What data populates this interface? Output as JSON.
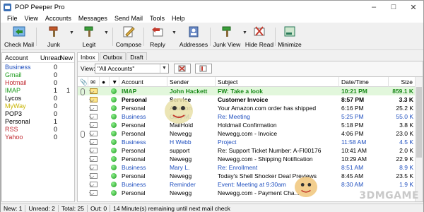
{
  "window": {
    "title": "POP Peeper Pro"
  },
  "menu": [
    "File",
    "View",
    "Accounts",
    "Messages",
    "Send Mail",
    "Tools",
    "Help"
  ],
  "toolbar": {
    "check_mail": "Check Mail",
    "junk": "Junk",
    "legit": "Legit",
    "compose": "Compose",
    "reply": "Reply",
    "addresses": "Addresses",
    "junk_view": "Junk View",
    "hide_read": "Hide Read",
    "minimize": "Minimize"
  },
  "accounts": {
    "headers": {
      "account": "Account",
      "unread": "Unread",
      "new": "New"
    },
    "rows": [
      {
        "name": "Business",
        "unread": "0",
        "new": "",
        "color": "#1f4fbf"
      },
      {
        "name": "Gmail",
        "unread": "0",
        "new": "",
        "color": "#1a9a1a"
      },
      {
        "name": "Hotmail",
        "unread": "0",
        "new": "",
        "color": "#c0282f"
      },
      {
        "name": "IMAP",
        "unread": "1",
        "new": "1",
        "color": "#1a9a1a"
      },
      {
        "name": "Lycos",
        "unread": "0",
        "new": "",
        "color": "#000000"
      },
      {
        "name": "MyWay",
        "unread": "0",
        "new": "",
        "color": "#c8b400"
      },
      {
        "name": "POP3",
        "unread": "0",
        "new": "",
        "color": "#000000"
      },
      {
        "name": "Personal",
        "unread": "1",
        "new": "",
        "color": "#000000"
      },
      {
        "name": "RSS",
        "unread": "0",
        "new": "",
        "color": "#c0282f"
      },
      {
        "name": "Yahoo",
        "unread": "0",
        "new": "",
        "color": "#c0282f"
      }
    ]
  },
  "tabs": [
    "Inbox",
    "Outbox",
    "Draft"
  ],
  "view": {
    "label": "View:",
    "selected": "\"All Accounts\""
  },
  "grid": {
    "headers": {
      "account": "Account",
      "sender": "Sender",
      "subject": "Subject",
      "date": "Date/Time",
      "size": "Size"
    },
    "rows": [
      {
        "account": "IMAP",
        "sender": "John Hackett",
        "subject": "FW: Take a look",
        "date": "10:21 PM",
        "size": "859.1 K",
        "color": "#1a8a1a",
        "bold": true,
        "bg": "#e2f7dc",
        "unread": true,
        "attach": true
      },
      {
        "account": "Personal",
        "sender": "Service",
        "subject": "Customer Invoice",
        "date": "8:57 PM",
        "size": "3.3 K",
        "color": "#000000",
        "bold": true,
        "bg": "#ffffff",
        "unread": true,
        "attach": false
      },
      {
        "account": "Personal",
        "sender": "Amazon",
        "subject": "Your Amazon.com order has shipped",
        "date": "6:16 PM",
        "size": "25.2 K",
        "color": "#000000",
        "bold": false,
        "bg": "#ffffff",
        "unread": false,
        "attach": false
      },
      {
        "account": "Business",
        "sender": "Gary M.",
        "subject": "Re: Meeting",
        "date": "5:25 PM",
        "size": "55.0 K",
        "color": "#1f4fbf",
        "bold": false,
        "bg": "#ffffff",
        "unread": false,
        "attach": false
      },
      {
        "account": "Personal",
        "sender": "MailHold",
        "subject": "Holdmail Confirmation",
        "date": "5:18 PM",
        "size": "3.8 K",
        "color": "#000000",
        "bold": false,
        "bg": "#ffffff",
        "unread": false,
        "attach": false
      },
      {
        "account": "Personal",
        "sender": "Newegg",
        "subject": "Newegg.com - Invoice",
        "date": "4:06 PM",
        "size": "23.0 K",
        "color": "#000000",
        "bold": false,
        "bg": "#ffffff",
        "unread": false,
        "attach": true
      },
      {
        "account": "Business",
        "sender": "H Webb",
        "subject": "Project",
        "date": "11:58 AM",
        "size": "4.5 K",
        "color": "#1f4fbf",
        "bold": false,
        "bg": "#ffffff",
        "unread": false,
        "attach": false
      },
      {
        "account": "Personal",
        "sender": "support",
        "subject": "Re: Support Ticket Number: A-FI00176",
        "date": "10:41 AM",
        "size": "2.0 K",
        "color": "#000000",
        "bold": false,
        "bg": "#ffffff",
        "unread": false,
        "attach": false
      },
      {
        "account": "Personal",
        "sender": "Newegg",
        "subject": "Newegg.com - Shipping Notification",
        "date": "10:29 AM",
        "size": "22.9 K",
        "color": "#000000",
        "bold": false,
        "bg": "#ffffff",
        "unread": false,
        "attach": false
      },
      {
        "account": "Business",
        "sender": "Mary L.",
        "subject": "Re: Enrollment",
        "date": "8:51 AM",
        "size": "8.9 K",
        "color": "#1f4fbf",
        "bold": false,
        "bg": "#ffffff",
        "unread": false,
        "attach": false
      },
      {
        "account": "Personal",
        "sender": "Newegg",
        "subject": "Today's Shell Shocker Deal Previews",
        "date": "8:45 AM",
        "size": "23.5 K",
        "color": "#000000",
        "bold": false,
        "bg": "#ffffff",
        "unread": false,
        "attach": false
      },
      {
        "account": "Business",
        "sender": "Reminder",
        "subject": "Event: Meeting at 9:30am",
        "date": "8:30 AM",
        "size": "1.9 K",
        "color": "#1f4fbf",
        "bold": false,
        "bg": "#ffffff",
        "unread": false,
        "attach": false
      },
      {
        "account": "Personal",
        "sender": "Newegg",
        "subject": "Newegg.com - Payment  Cha...",
        "date": "",
        "size": "",
        "color": "#000000",
        "bold": false,
        "bg": "#ffffff",
        "unread": false,
        "attach": false
      }
    ]
  },
  "status": {
    "new": "New: 1",
    "unread": "Unread: 2",
    "total": "Total: 25",
    "out": "Out: 0",
    "next_check": "14 Minute(s) remaining until next mail check"
  },
  "watermark": "3DMGAME"
}
